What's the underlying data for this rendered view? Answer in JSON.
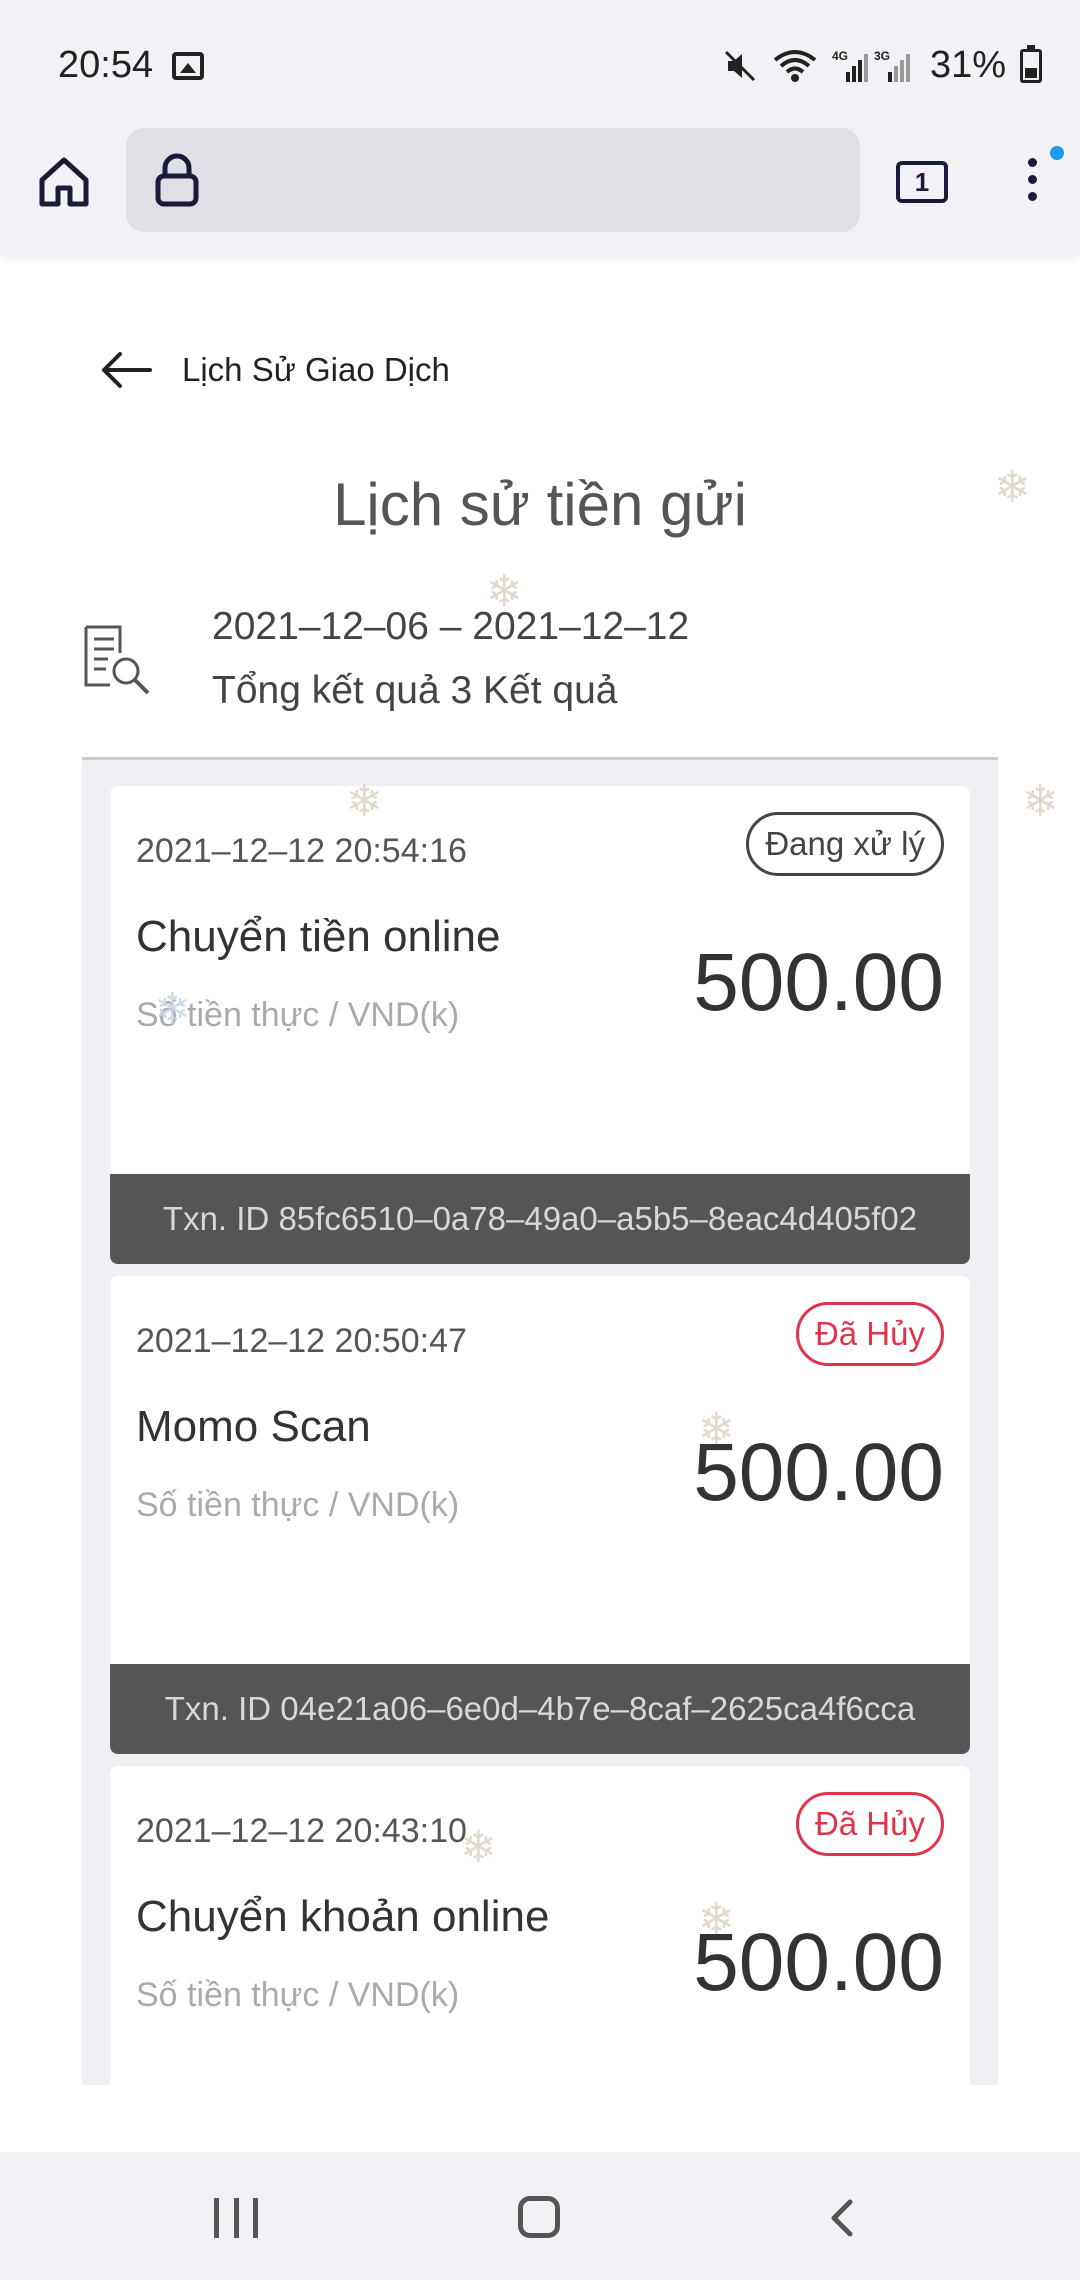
{
  "status_bar": {
    "time": "20:54",
    "battery": "31%",
    "network_labels": [
      "4G",
      "3G"
    ],
    "icons": [
      "image-icon",
      "mute-icon",
      "wifi-icon",
      "signal-icon",
      "battery-icon"
    ]
  },
  "browser": {
    "tab_count": "1",
    "icons": [
      "home-icon",
      "lock-icon",
      "tabs-icon",
      "more-menu-icon"
    ]
  },
  "header": {
    "back_label": "Lịch Sử Giao Dịch",
    "title": "Lịch sử tiền gửi"
  },
  "summary": {
    "date_range": "2021–12–06 – 2021–12–12",
    "total": "Tổng kết quả 3 Kết quả"
  },
  "transactions": [
    {
      "time": "2021–12–12 20:54:16",
      "status": "Đang xử lý",
      "name": "Chuyển tiền online",
      "sub": "Số tiền thực / VND(k)",
      "amount": "500.00",
      "txn_id": "Txn. ID 85fc6510–0a78–49a0–a5b5–8eac4d405f02"
    },
    {
      "time": "2021–12–12 20:50:47",
      "status": "Đã Hủy",
      "name": "Momo Scan",
      "sub": "Số tiền thực / VND(k)",
      "amount": "500.00",
      "txn_id": "Txn. ID 04e21a06–6e0d–4b7e–8caf–2625ca4f6cca"
    },
    {
      "time": "2021–12–12 20:43:10",
      "status": "Đã Hủy",
      "name": "Chuyển khoản online",
      "sub": "Số tiền thực / VND(k)",
      "amount": "500.00",
      "txn_id": ""
    }
  ],
  "colors": {
    "accent_cancel": "#e0344b",
    "footer_bg": "#555555",
    "list_bg": "#efeff4"
  },
  "nav": {
    "icons": [
      "recent-apps-icon",
      "home-nav-icon",
      "back-nav-icon"
    ]
  }
}
